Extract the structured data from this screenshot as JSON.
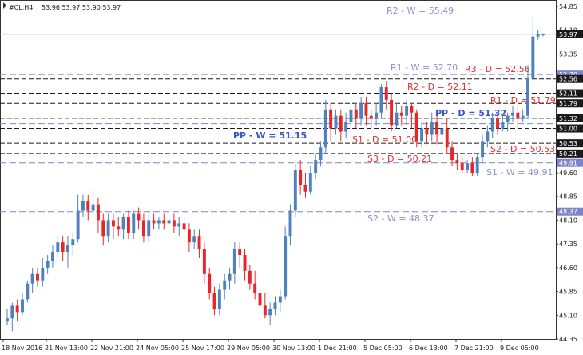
{
  "header": {
    "symbol": "#CL,H4",
    "ohlc": "53.96 53.97 53.90 53.97"
  },
  "colors": {
    "bull": "#4f81bd",
    "bear": "#e8262a",
    "weekly_line": "#7b86c8",
    "daily_line": "#1a1a1a",
    "weekly_label": "#8a8fd0",
    "daily_label": "#e03030",
    "pivot_label": "#3a56c8",
    "price_tag_bg": "#1a1a1a",
    "weekly_tag_bg": "#7b86c8"
  },
  "chart_data": {
    "type": "candlestick",
    "y_range": [
      44.35,
      54.85
    ],
    "y_ticks": [
      "54.85",
      "54.10",
      "53.35",
      "52.56",
      "52.11",
      "51.79",
      "51.32",
      "51.00",
      "50.53",
      "50.21",
      "49.91",
      "49.60",
      "48.85",
      "48.37",
      "48.10",
      "47.35",
      "46.60",
      "45.85",
      "45.10",
      "44.35"
    ],
    "x_tick_labels": [
      "18 Nov 2016",
      "21 Nov 13:00",
      "22 Nov 21:00",
      "24 Nov 05:00",
      "25 Nov 17:00",
      "29 Nov 05:00",
      "30 Nov 13:00",
      "1 Dec 21:00",
      "5 Dec 05:00",
      "6 Dec 13:00",
      "7 Dec 21:00",
      "9 Dec 05:00"
    ],
    "current_price": "53.97",
    "weekly_levels": [
      {
        "label": "R2 - W = 55.49",
        "value": 55.49,
        "tag": null
      },
      {
        "label": "R1 - W = 52.70",
        "value": 52.7,
        "tag": "52.70"
      },
      {
        "label": "PP - W = 51.15",
        "value": 51.15,
        "tag": null
      },
      {
        "label": "S1 - W = 49.91",
        "value": 49.91,
        "tag": "49.91"
      },
      {
        "label": "S2 - W = 48.37",
        "value": 48.37,
        "tag": "48.37"
      }
    ],
    "daily_levels": [
      {
        "label": "R3 - D = 52.56",
        "value": 52.56,
        "tag": "52.56"
      },
      {
        "label": "R2 - D = 52.11",
        "value": 52.11,
        "tag": "52.11"
      },
      {
        "label": "R1 - D = 51.79",
        "value": 51.79,
        "tag": "51.79"
      },
      {
        "label": "PP - D = 51.32",
        "value": 51.32,
        "tag": "51.32"
      },
      {
        "label": "S1 - D = 51.00",
        "value": 51.0,
        "tag": "51.00"
      },
      {
        "label": "S2 - D = 50.53",
        "value": 50.53,
        "tag": "50.53"
      },
      {
        "label": "S3 - D = 50.21",
        "value": 50.21,
        "tag": "50.21"
      }
    ],
    "candles": [
      [
        44.9,
        45.0,
        45.3,
        44.8
      ],
      [
        45.0,
        45.4,
        45.5,
        44.6
      ],
      [
        45.4,
        45.2,
        45.6,
        44.9
      ],
      [
        45.2,
        45.6,
        45.8,
        45.1
      ],
      [
        45.6,
        46.1,
        46.2,
        45.5
      ],
      [
        46.1,
        46.4,
        46.6,
        45.8
      ],
      [
        46.4,
        46.2,
        46.6,
        46.0
      ],
      [
        46.2,
        46.6,
        46.9,
        46.0
      ],
      [
        46.6,
        46.8,
        47.0,
        46.4
      ],
      [
        46.8,
        47.1,
        47.3,
        46.6
      ],
      [
        47.1,
        47.4,
        47.6,
        46.9
      ],
      [
        47.4,
        47.1,
        47.6,
        46.8
      ],
      [
        47.1,
        47.3,
        47.6,
        46.6
      ],
      [
        47.3,
        47.5,
        47.7,
        47.0
      ],
      [
        47.5,
        48.4,
        48.9,
        47.4
      ],
      [
        48.4,
        48.7,
        48.9,
        48.2
      ],
      [
        48.7,
        48.4,
        48.9,
        48.1
      ],
      [
        48.4,
        48.6,
        49.1,
        48.2
      ],
      [
        48.6,
        48.1,
        48.8,
        47.7
      ],
      [
        48.1,
        47.6,
        48.3,
        47.3
      ],
      [
        47.6,
        48.1,
        48.3,
        47.4
      ],
      [
        48.1,
        47.9,
        48.3,
        47.5
      ],
      [
        47.9,
        47.8,
        48.2,
        47.6
      ],
      [
        47.8,
        48.2,
        48.3,
        47.5
      ],
      [
        48.2,
        47.7,
        48.4,
        47.5
      ],
      [
        47.7,
        48.3,
        48.4,
        47.5
      ],
      [
        48.3,
        48.1,
        48.5,
        47.8
      ],
      [
        48.1,
        47.6,
        48.3,
        47.4
      ],
      [
        47.6,
        48.1,
        48.3,
        47.4
      ],
      [
        48.1,
        48.0,
        48.3,
        47.8
      ],
      [
        48.0,
        48.1,
        48.2,
        47.8
      ],
      [
        48.1,
        48.0,
        48.3,
        47.8
      ],
      [
        48.0,
        48.1,
        48.3,
        47.9
      ],
      [
        48.1,
        47.9,
        48.3,
        47.7
      ],
      [
        47.9,
        48.0,
        48.2,
        47.6
      ],
      [
        48.0,
        47.8,
        48.2,
        47.6
      ],
      [
        47.8,
        47.4,
        48.0,
        47.1
      ],
      [
        47.4,
        47.6,
        47.8,
        47.2
      ],
      [
        47.6,
        47.2,
        47.8,
        46.9
      ],
      [
        47.2,
        46.4,
        47.4,
        46.1
      ],
      [
        46.4,
        45.8,
        46.6,
        45.6
      ],
      [
        45.8,
        45.3,
        46.0,
        45.1
      ],
      [
        45.3,
        45.9,
        46.1,
        45.1
      ],
      [
        45.9,
        46.2,
        46.4,
        45.6
      ],
      [
        46.2,
        46.4,
        46.6,
        45.9
      ],
      [
        46.4,
        47.2,
        47.4,
        46.1
      ],
      [
        47.2,
        47.0,
        47.4,
        46.6
      ],
      [
        47.0,
        46.5,
        47.2,
        46.2
      ],
      [
        46.5,
        46.1,
        46.7,
        45.9
      ],
      [
        46.1,
        45.8,
        46.5,
        45.6
      ],
      [
        45.8,
        45.4,
        46.1,
        45.2
      ],
      [
        45.4,
        45.1,
        45.8,
        45.0
      ],
      [
        45.1,
        45.3,
        45.5,
        44.8
      ],
      [
        45.3,
        45.5,
        45.7,
        45.1
      ],
      [
        45.5,
        45.7,
        45.9,
        45.2
      ],
      [
        45.7,
        47.6,
        47.9,
        45.6
      ],
      [
        47.6,
        48.4,
        48.6,
        47.3
      ],
      [
        48.4,
        49.7,
        49.9,
        48.2
      ],
      [
        49.7,
        49.2,
        50.0,
        48.9
      ],
      [
        49.2,
        49.0,
        49.6,
        48.8
      ],
      [
        49.0,
        49.6,
        49.8,
        48.9
      ],
      [
        49.6,
        50.0,
        50.2,
        49.4
      ],
      [
        50.0,
        50.4,
        50.6,
        49.8
      ],
      [
        50.4,
        51.6,
        51.9,
        50.2
      ],
      [
        51.6,
        51.0,
        51.8,
        50.6
      ],
      [
        51.0,
        51.4,
        51.6,
        50.8
      ],
      [
        51.4,
        50.9,
        51.6,
        50.6
      ],
      [
        50.9,
        51.2,
        51.5,
        50.7
      ],
      [
        51.2,
        51.6,
        51.8,
        50.9
      ],
      [
        51.6,
        51.3,
        51.8,
        51.0
      ],
      [
        51.3,
        51.8,
        52.0,
        51.1
      ],
      [
        51.8,
        51.4,
        52.0,
        51.1
      ],
      [
        51.4,
        51.3,
        51.6,
        51.0
      ],
      [
        51.3,
        51.5,
        51.8,
        51.1
      ],
      [
        51.5,
        52.3,
        52.4,
        51.3
      ],
      [
        52.3,
        51.9,
        52.5,
        51.6
      ],
      [
        51.9,
        51.1,
        52.1,
        50.9
      ],
      [
        51.1,
        51.5,
        51.8,
        51.0
      ],
      [
        51.5,
        51.4,
        51.7,
        51.1
      ],
      [
        51.4,
        51.7,
        51.9,
        51.1
      ],
      [
        51.7,
        51.5,
        51.8,
        51.0
      ],
      [
        51.5,
        50.6,
        51.6,
        50.4
      ],
      [
        50.6,
        51.0,
        51.2,
        50.4
      ],
      [
        51.0,
        50.8,
        51.2,
        50.5
      ],
      [
        50.8,
        51.2,
        51.5,
        50.6
      ],
      [
        51.2,
        50.8,
        51.4,
        50.5
      ],
      [
        50.8,
        51.0,
        51.2,
        50.3
      ],
      [
        51.0,
        50.4,
        51.3,
        50.2
      ],
      [
        50.4,
        50.0,
        50.6,
        49.8
      ],
      [
        50.0,
        49.9,
        50.2,
        49.7
      ],
      [
        49.9,
        49.7,
        50.1,
        49.6
      ],
      [
        49.7,
        49.9,
        50.0,
        49.6
      ],
      [
        49.9,
        49.6,
        50.1,
        49.5
      ],
      [
        49.6,
        50.1,
        50.2,
        49.5
      ],
      [
        50.1,
        50.6,
        50.8,
        49.9
      ],
      [
        50.6,
        50.9,
        51.1,
        50.4
      ],
      [
        50.9,
        51.3,
        51.5,
        50.7
      ],
      [
        51.3,
        51.0,
        51.4,
        50.8
      ],
      [
        51.0,
        51.2,
        51.4,
        50.9
      ],
      [
        51.2,
        51.4,
        51.5,
        50.9
      ],
      [
        51.4,
        51.5,
        51.7,
        51.2
      ],
      [
        51.5,
        51.3,
        51.7,
        51.0
      ],
      [
        51.3,
        51.4,
        51.6,
        51.2
      ],
      [
        51.4,
        52.6,
        53.0,
        51.3
      ],
      [
        52.6,
        53.9,
        54.5,
        52.5
      ],
      [
        53.9,
        53.97,
        54.1,
        53.8
      ],
      [
        53.96,
        53.97,
        54.0,
        53.9
      ]
    ]
  }
}
